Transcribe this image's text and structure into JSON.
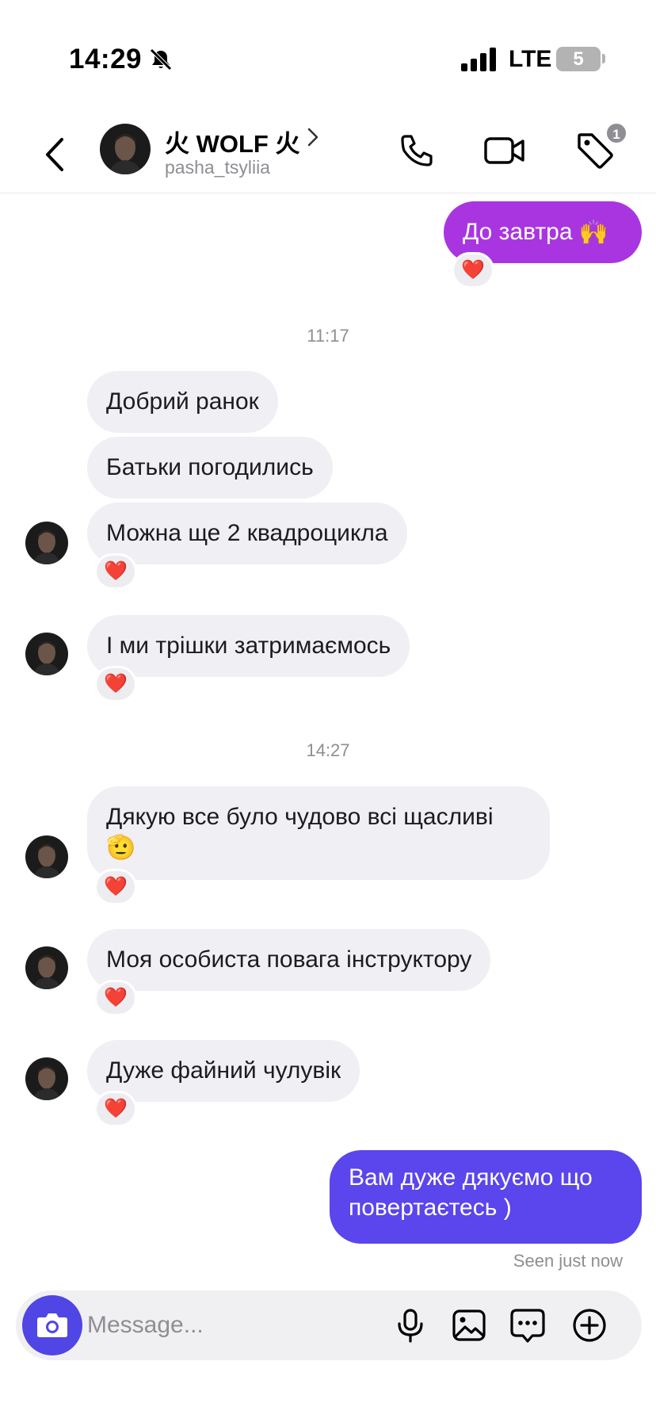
{
  "status": {
    "time": "14:29",
    "network": "LTE",
    "battery": "5"
  },
  "header": {
    "name": "火 WOLF 火",
    "username": "pasha_tsyliia",
    "badge_count": "1"
  },
  "messages": {
    "m1": {
      "text": "До завтра",
      "emoji": "🙌",
      "reaction": "❤️"
    },
    "t1": "11:17",
    "m2": {
      "text": "Добрий ранок"
    },
    "m3": {
      "text": "Батьки погодились"
    },
    "m4": {
      "text": "Можна ще 2 квадроцикла",
      "reaction": "❤️"
    },
    "m5": {
      "text": "І ми трішки затримаємось",
      "reaction": "❤️"
    },
    "t2": "14:27",
    "m6": {
      "text": "Дякую все було чудово всі щасливі",
      "emoji": "🫡",
      "reaction": "❤️"
    },
    "m7": {
      "text": "Моя особиста повага інструктору",
      "reaction": "❤️"
    },
    "m8": {
      "text": "Дуже файний чулувік",
      "reaction": "❤️"
    },
    "m9": {
      "text": "Вам  дуже дякуємо що повертаєтесь )"
    },
    "seen": "Seen just now"
  },
  "composer": {
    "placeholder": "Message..."
  },
  "colors": {
    "bubble_in": "#efeff4",
    "bubble_out_1": "#a935e0",
    "bubble_out_2": "#5b45ec",
    "camera_button": "#4f46e5",
    "heart": "#e02440"
  },
  "icons": [
    "bell-slash-icon",
    "signal-icon",
    "back-chevron-icon",
    "chevron-right-icon",
    "phone-icon",
    "video-camera-icon",
    "tag-icon",
    "camera-icon",
    "microphone-icon",
    "image-icon",
    "sticker-icon",
    "plus-circle-icon"
  ]
}
